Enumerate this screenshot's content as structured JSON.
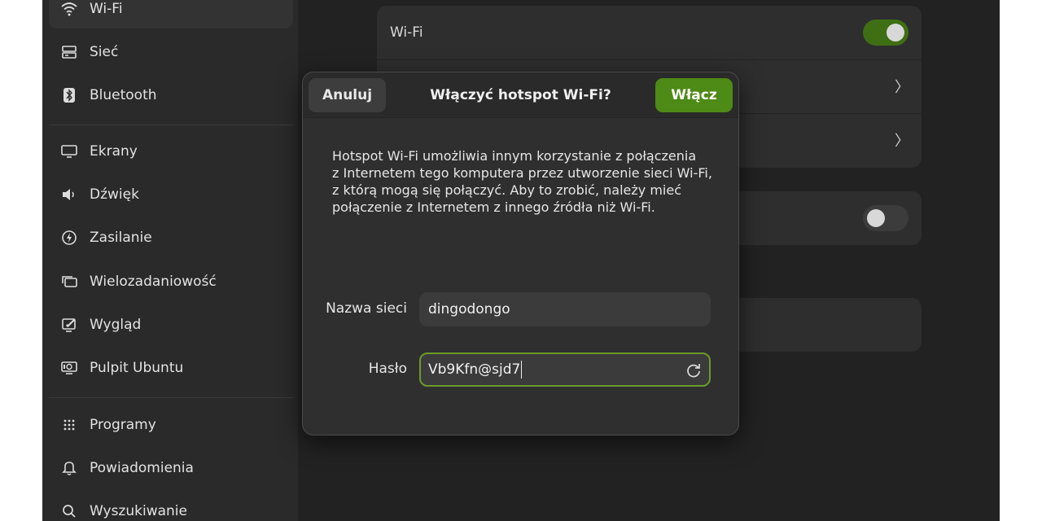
{
  "sidebar": {
    "items": [
      {
        "label": "Wi-Fi",
        "icon": "wifi-icon"
      },
      {
        "label": "Sieć",
        "icon": "network-icon"
      },
      {
        "label": "Bluetooth",
        "icon": "bluetooth-icon"
      },
      {
        "label": "Ekrany",
        "icon": "display-icon"
      },
      {
        "label": "Dźwięk",
        "icon": "speaker-icon"
      },
      {
        "label": "Zasilanie",
        "icon": "power-icon"
      },
      {
        "label": "Wielozadaniowość",
        "icon": "multitasking-icon"
      },
      {
        "label": "Wygląd",
        "icon": "appearance-icon"
      },
      {
        "label": "Pulpit Ubuntu",
        "icon": "ubuntu-desktop-icon"
      },
      {
        "label": "Programy",
        "icon": "apps-grid-icon"
      },
      {
        "label": "Powiadomienia",
        "icon": "bell-icon"
      },
      {
        "label": "Wyszukiwanie",
        "icon": "search-icon"
      }
    ]
  },
  "main": {
    "wifi_row_label": "Wi-Fi",
    "wifi_enabled": true
  },
  "dialog": {
    "title": "Włączyć hotspot Wi-Fi?",
    "cancel_label": "Anuluj",
    "confirm_label": "Włącz",
    "body_lines": [
      "Hotspot Wi-Fi umożliwia innym korzystanie z połączenia",
      "z Internetem tego komputera przez utworzenie sieci Wi-Fi,",
      "z którą mogą się połączyć. Aby to zrobić, należy mieć",
      "połączenie z Internetem z innego źródła niż Wi-Fi."
    ],
    "network_name_label": "Nazwa sieci",
    "network_name_value": "dingodongo",
    "password_label": "Hasło",
    "password_value": "Vb9Kfn@sjd7"
  },
  "colors": {
    "accent": "#4e8a16",
    "focus_ring": "#6b9a2a",
    "window_bg": "#222222",
    "sidebar_bg": "#2a2a2a"
  }
}
